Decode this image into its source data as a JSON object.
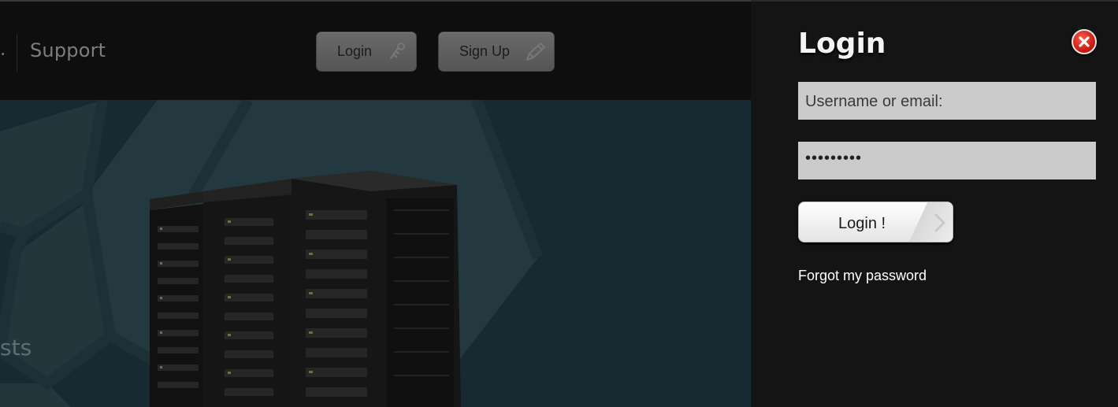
{
  "header": {
    "nav_fragment": ".",
    "nav_support": "Support",
    "login_label": "Login",
    "signup_label": "Sign Up"
  },
  "hero": {
    "partial_text": "sts"
  },
  "login_panel": {
    "title": "Login",
    "username_placeholder": "Username or email:",
    "password_value": "•••••••••",
    "submit_label": "Login !",
    "forgot_label": "Forgot my password"
  },
  "icons": {
    "login_button_icon": "key-icon",
    "signup_button_icon": "pencil-icon",
    "close_icon": "close-icon",
    "submit_icon": "arrow-icon"
  },
  "colors": {
    "panel_bg": "#141414",
    "hero_bg": "#172a31",
    "close_red": "#d9261a"
  }
}
